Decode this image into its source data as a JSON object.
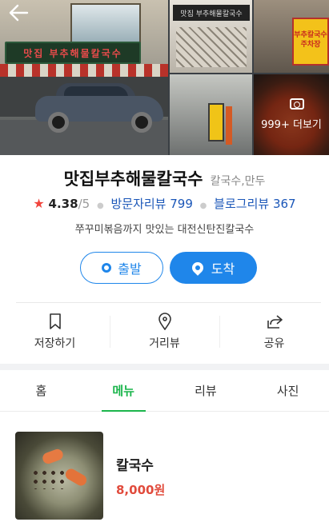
{
  "photos": {
    "main_sign_text": "맛집 부추해물칼국수",
    "thumb1_sign_text": "맛집 부추해물칼국수",
    "thumb2_sign_text": "부추칼국수 주차장",
    "more_label": "999+ 더보기"
  },
  "place": {
    "name": "맛집부추해물칼국수",
    "category": "칼국수,만두",
    "rating": "4.38",
    "rating_max": "/5",
    "visitor_reviews": "방문자리뷰 799",
    "blog_reviews": "블로그리뷰 367",
    "description": "쭈꾸미볶음까지 맛있는 대전신탄진칼국수"
  },
  "buttons": {
    "departure": "출발",
    "arrival": "도착"
  },
  "actions": [
    {
      "label": "저장하기",
      "icon": "bookmark-icon"
    },
    {
      "label": "거리뷰",
      "icon": "location-pin-icon"
    },
    {
      "label": "공유",
      "icon": "share-icon"
    }
  ],
  "tabs": [
    {
      "label": "홈",
      "active": false
    },
    {
      "label": "메뉴",
      "active": true
    },
    {
      "label": "리뷰",
      "active": false
    },
    {
      "label": "사진",
      "active": false
    }
  ],
  "menu": [
    {
      "name": "칼국수",
      "price": "8,000원"
    }
  ],
  "colors": {
    "accent_blue": "#1f86ea",
    "active_tab_green": "#1bb54c",
    "price_red": "#e14b3c",
    "star_red": "#f1453d",
    "link_blue": "#1a56b8"
  }
}
